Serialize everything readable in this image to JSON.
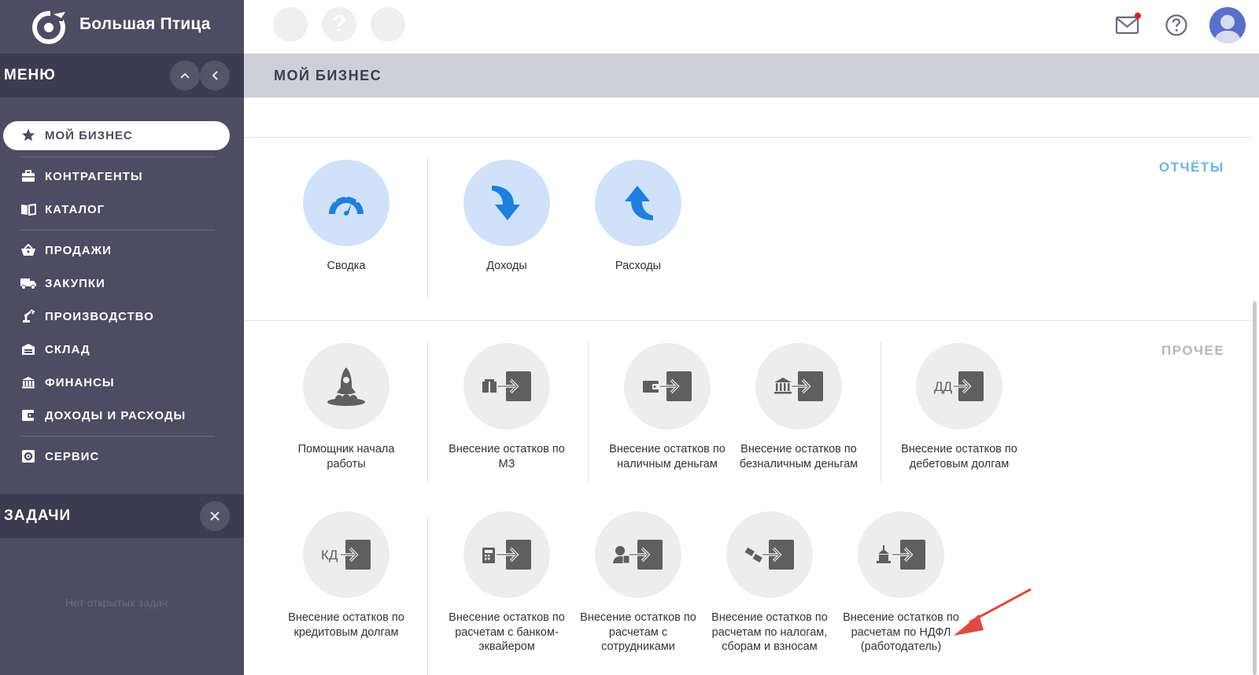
{
  "app": {
    "name": "Большая Птица"
  },
  "sidebar": {
    "menu_title": "МЕНЮ",
    "items": [
      {
        "label": "МОЙ БИЗНЕС",
        "icon": "star-icon",
        "active": true
      },
      {
        "label": "КОНТРАГЕНТЫ",
        "icon": "briefcase-icon"
      },
      {
        "label": "КАТАЛОГ",
        "icon": "book-icon"
      },
      {
        "label": "ПРОДАЖИ",
        "icon": "basket-icon"
      },
      {
        "label": "ЗАКУПКИ",
        "icon": "truck-icon"
      },
      {
        "label": "ПРОИЗВОДСТВО",
        "icon": "robot-arm-icon"
      },
      {
        "label": "СКЛАД",
        "icon": "warehouse-icon"
      },
      {
        "label": "ФИНАНСЫ",
        "icon": "bank-icon"
      },
      {
        "label": "ДОХОДЫ И РАСХОДЫ",
        "icon": "wallet-icon"
      },
      {
        "label": "СЕРВИС",
        "icon": "gear-box-icon"
      }
    ],
    "tasks_title": "ЗАДАЧИ",
    "tasks_empty": "Нет открытых задач"
  },
  "topbar": {
    "help_glyph": "?",
    "mail_has_notification": true
  },
  "page": {
    "title": "МОЙ БИЗНЕС",
    "reports_label": "ОТЧЁТЫ",
    "other_label": "ПРОЧЕЕ",
    "reports": [
      {
        "label": "Сводка",
        "icon": "speedometer-icon"
      },
      {
        "label": "Доходы",
        "icon": "arrow-down-curved-icon"
      },
      {
        "label": "Расходы",
        "icon": "arrow-up-curved-icon"
      }
    ],
    "other_row1": [
      {
        "label": "Помощник начала работы",
        "icon": "rocket-icon"
      },
      {
        "label": "Внесение остатков по МЗ",
        "icon": "import-goods-icon"
      },
      {
        "label": "Внесение остатков по наличным деньгам",
        "icon": "import-cash-icon"
      },
      {
        "label": "Внесение остатков по безналичным деньгам",
        "icon": "import-bank-icon"
      },
      {
        "label": "Внесение остатков по дебетовым долгам",
        "icon": "import-dd-icon"
      }
    ],
    "other_row2": [
      {
        "label": "Внесение остатков по кредитовым долгам",
        "icon": "import-kd-icon"
      },
      {
        "label": "Внесение остатков по расчетам с банком-эквайером",
        "icon": "import-terminal-icon"
      },
      {
        "label": "Внесение остатков по расчетам с сотрудниками",
        "icon": "import-employee-icon"
      },
      {
        "label": "Внесение остатков по расчетам по налогам, сборам и взносам",
        "icon": "import-taxes-icon"
      },
      {
        "label": "Внесение остатков по расчетам по НДФЛ (работодатель)",
        "icon": "import-ndfl-icon"
      }
    ],
    "dd_text": "ДД",
    "kd_text": "КД"
  },
  "colors": {
    "sidebar_bg": "#4d4c62",
    "sidebar_header_bg": "#3c3b4f",
    "accent_blue": "#1e7fe0",
    "reports_label": "#6cb3ee",
    "icon_gray": "#5f5f5f",
    "arrow_red": "#e04a3f"
  }
}
